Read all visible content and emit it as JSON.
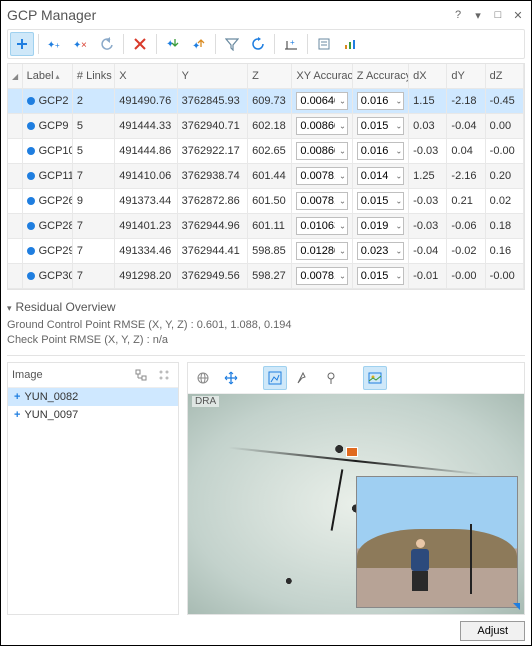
{
  "window": {
    "title": "GCP Manager"
  },
  "table": {
    "headers": {
      "label": "Label",
      "links": "# Links",
      "x": "X",
      "y": "Y",
      "z": "Z",
      "xy_acc": "XY Accuracy",
      "z_acc": "Z Accuracy",
      "dx": "dX",
      "dy": "dY",
      "dz": "dZ"
    },
    "rows": [
      {
        "label": "GCP2",
        "links": "2",
        "x": "491490.76",
        "y": "3762845.93",
        "z": "609.73",
        "xy": "0.00640",
        "za": "0.016",
        "dx": "1.15",
        "dy": "-2.18",
        "dz": "-0.45"
      },
      {
        "label": "GCP9",
        "links": "5",
        "x": "491444.33",
        "y": "3762940.71",
        "z": "602.18",
        "xy": "0.00860",
        "za": "0.015",
        "dx": "0.03",
        "dy": "-0.04",
        "dz": "0.00"
      },
      {
        "label": "GCP10",
        "links": "5",
        "x": "491444.86",
        "y": "3762922.17",
        "z": "602.65",
        "xy": "0.00860",
        "za": "0.016",
        "dx": "-0.03",
        "dy": "0.04",
        "dz": "-0.00"
      },
      {
        "label": "GCP11",
        "links": "7",
        "x": "491410.06",
        "y": "3762938.74",
        "z": "601.44",
        "xy": "0.00781",
        "za": "0.014",
        "dx": "1.25",
        "dy": "-2.16",
        "dz": "0.20"
      },
      {
        "label": "GCP26",
        "links": "9",
        "x": "491373.44",
        "y": "3762872.86",
        "z": "601.50",
        "xy": "0.00781",
        "za": "0.015",
        "dx": "-0.03",
        "dy": "0.21",
        "dz": "0.02"
      },
      {
        "label": "GCP28",
        "links": "7",
        "x": "491401.23",
        "y": "3762944.96",
        "z": "601.11",
        "xy": "0.01063",
        "za": "0.019",
        "dx": "-0.03",
        "dy": "-0.06",
        "dz": "0.18"
      },
      {
        "label": "GCP29",
        "links": "7",
        "x": "491334.46",
        "y": "3762944.41",
        "z": "598.85",
        "xy": "0.01280",
        "za": "0.023",
        "dx": "-0.04",
        "dy": "-0.02",
        "dz": "0.16"
      },
      {
        "label": "GCP30",
        "links": "7",
        "x": "491298.20",
        "y": "3762949.56",
        "z": "598.27",
        "xy": "0.00781",
        "za": "0.015",
        "dx": "-0.01",
        "dy": "-0.00",
        "dz": "-0.00"
      }
    ]
  },
  "overview": {
    "title": "Residual Overview",
    "line1": "Ground Control Point RMSE (X, Y, Z) : 0.601, 1.088, 0.194",
    "line2": "Check Point RMSE (X, Y, Z) : n/a"
  },
  "imagePane": {
    "title": "Image",
    "items": [
      {
        "name": "YUN_0082"
      },
      {
        "name": "YUN_0097"
      }
    ]
  },
  "viewer": {
    "overlay": "DRA"
  },
  "footer": {
    "adjust": "Adjust"
  },
  "icons": {
    "add_gcp": "add-gcp-icon",
    "filter": "filter-icon",
    "refresh": "refresh-icon"
  }
}
